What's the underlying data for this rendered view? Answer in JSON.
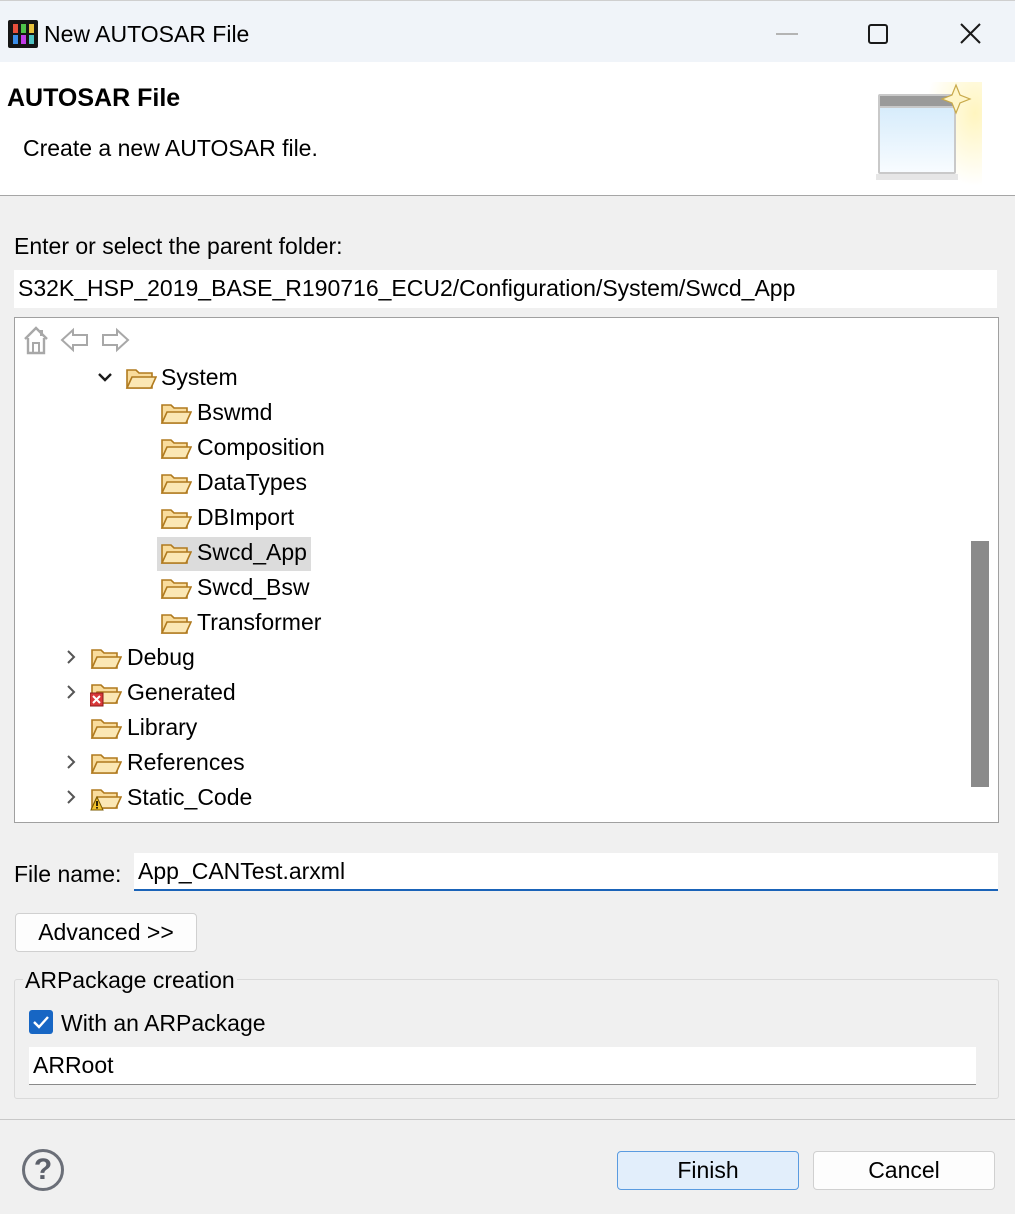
{
  "window": {
    "title": "New AUTOSAR File",
    "buttons": [
      "minimize-icon",
      "maximize-icon",
      "close-icon"
    ]
  },
  "banner": {
    "title": "AUTOSAR File",
    "description": "Create a new AUTOSAR file."
  },
  "parent_folder": {
    "label": "Enter or select the parent folder:",
    "value": "S32K_HSP_2019_BASE_R190716_ECU2/Configuration/System/Swcd_App"
  },
  "tree_toolbar": [
    "home-icon",
    "back-arrow-icon",
    "forward-arrow-icon"
  ],
  "tree": {
    "items": [
      {
        "label": "System",
        "expanded": true,
        "icon": "folder-open-icon"
      },
      {
        "label": "Bswmd",
        "icon": "folder-icon"
      },
      {
        "label": "Composition",
        "icon": "folder-icon"
      },
      {
        "label": "DataTypes",
        "icon": "folder-icon"
      },
      {
        "label": "DBImport",
        "icon": "folder-icon"
      },
      {
        "label": "Swcd_App",
        "icon": "folder-icon",
        "selected": true
      },
      {
        "label": "Swcd_Bsw",
        "icon": "folder-icon"
      },
      {
        "label": "Transformer",
        "icon": "folder-icon"
      },
      {
        "label": "Debug",
        "expanded": false,
        "icon": "folder-icon"
      },
      {
        "label": "Generated",
        "expanded": false,
        "icon": "folder-error-icon"
      },
      {
        "label": "Library",
        "icon": "folder-icon"
      },
      {
        "label": "References",
        "expanded": false,
        "icon": "folder-icon"
      },
      {
        "label": "Static_Code",
        "expanded": false,
        "icon": "folder-warning-icon"
      }
    ]
  },
  "file_name": {
    "label": "File name:",
    "value": "App_CANTest.arxml"
  },
  "advanced_button": "Advanced >>",
  "arpackage": {
    "legend": "ARPackage creation",
    "checkbox_label": "With an ARPackage",
    "checked": true,
    "value": "ARRoot"
  },
  "footer": {
    "finish": "Finish",
    "cancel": "Cancel"
  },
  "colors": {
    "accent": "#1766c4",
    "selection": "#dcdcdc",
    "folder": "#f3c46b"
  }
}
